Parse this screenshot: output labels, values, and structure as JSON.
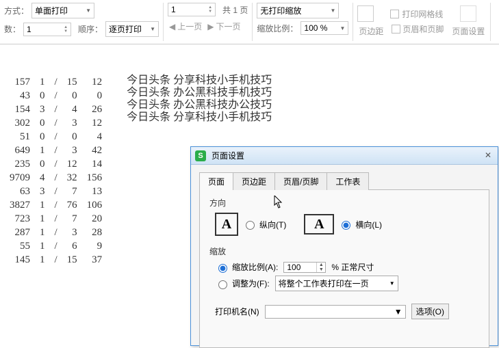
{
  "ribbon": {
    "mode_label": "方式：",
    "mode_value": "单面打印",
    "copies_label": "数：",
    "copies_value": "1",
    "order_label": "顺序：",
    "order_value": "逐页打印",
    "page_value": "1",
    "page_total_tmpl": "共 {n} 页",
    "page_total_n": 1,
    "prev_label": "上一页",
    "next_label": "下一页",
    "zoom_mode": "无打印缩放",
    "zoom_ratio_label": "缩放比例：",
    "zoom_ratio_value": "100 %",
    "gridlines_label": "打印网格线",
    "margins_label": "页边距",
    "headerfooter_label": "页眉和页脚",
    "pagesetup_label": "页面设置"
  },
  "table_rows": [
    [
      157,
      1,
      15,
      12
    ],
    [
      43,
      0,
      0,
      0
    ],
    [
      154,
      3,
      4,
      26
    ],
    [
      302,
      0,
      3,
      12
    ],
    [
      51,
      0,
      0,
      4
    ],
    [
      649,
      1,
      3,
      42
    ],
    [
      235,
      0,
      12,
      14
    ],
    [
      9709,
      4,
      32,
      156
    ],
    [
      63,
      3,
      7,
      13
    ],
    [
      3827,
      1,
      76,
      106
    ],
    [
      723,
      1,
      7,
      20
    ],
    [
      287,
      1,
      3,
      28
    ],
    [
      55,
      1,
      6,
      9
    ],
    [
      145,
      1,
      15,
      37
    ]
  ],
  "text_lines": [
    "今日头条   分享科技小手机技巧",
    "今日头条   办公黑科技手机技巧",
    "今日头条   办公黑科技办公技巧",
    "今日头条   分享科技小手机技巧"
  ],
  "dialog": {
    "title": "页面设置",
    "tabs": [
      "页面",
      "页边距",
      "页眉/页脚",
      "工作表"
    ],
    "active_tab": 0,
    "orientation_label": "方向",
    "portrait_label": "纵向(T)",
    "landscape_label": "横向(L)",
    "scale_label": "缩放",
    "scale_ratio_label": "缩放比例(A):",
    "scale_value": "100",
    "scale_suffix": "% 正常尺寸",
    "fit_to_label": "调整为(F):",
    "fit_to_value": "将整个工作表打印在一页",
    "printer_label": "打印机名(N)",
    "options_label": "选项(O)"
  }
}
